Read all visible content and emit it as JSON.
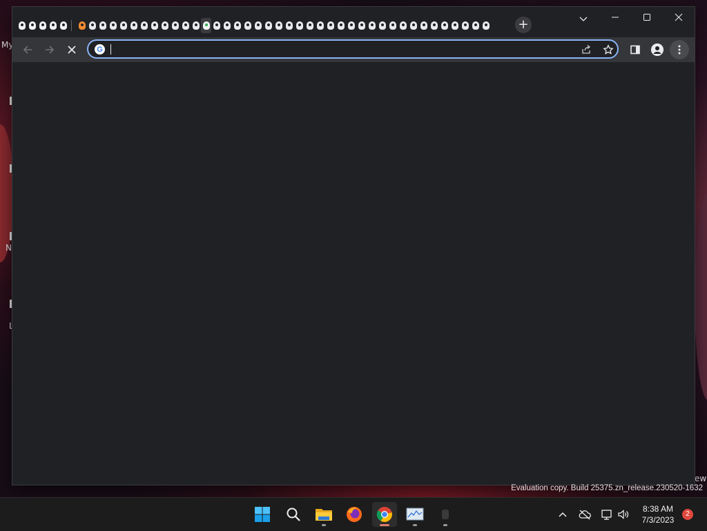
{
  "desktop": {
    "label_top": "My",
    "label_n": "N",
    "label_l": "L",
    "label_ew": "ew"
  },
  "browser": {
    "tabs": {
      "pinned_count": 5,
      "normal_count": 40,
      "special_index": 0,
      "google_index": 12,
      "active_index": 12
    },
    "new_tab_label": "+",
    "omnibox": {
      "value": "",
      "placeholder": ""
    }
  },
  "watermark": {
    "text": "Evaluation copy. Build 25375.zn_release.230520-1632"
  },
  "taskbar": {
    "time": "8:38 AM",
    "date": "7/3/2023",
    "notification_count": "2"
  },
  "icons": {
    "back": "arrow-left-icon",
    "forward": "arrow-right-icon",
    "stop": "close-icon",
    "share": "share-icon",
    "star": "star-icon",
    "side_panel": "side-panel-icon",
    "profile": "profile-icon",
    "menu": "more-vert-icon"
  },
  "colors": {
    "omnibox_focus": "#8ab4f8",
    "window_bg": "#202124",
    "toolbar_bg": "#35363a",
    "notification_badge": "#e0483e"
  }
}
